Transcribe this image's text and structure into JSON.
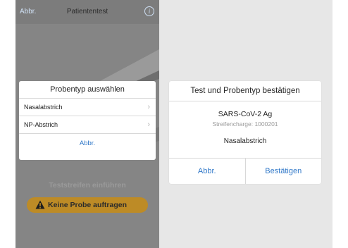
{
  "left": {
    "nav": {
      "cancel": "Abbr.",
      "title": "Patiententest",
      "info_icon": "info-icon"
    },
    "dialog": {
      "title": "Probentyp auswählen",
      "options": [
        {
          "label": "Nasalabstrich",
          "icon": "chevron-right-icon"
        },
        {
          "label": "NP-Abstrich",
          "icon": "chevron-right-icon"
        }
      ],
      "cancel": "Abbr."
    },
    "instruction": "Teststreifen einführen",
    "warning": {
      "icon": "warning-icon",
      "text": "Keine Probe auftragen",
      "color": "#bd8b26"
    }
  },
  "right": {
    "dialog": {
      "title": "Test und Probentyp bestätigen",
      "test_name": "SARS-CoV-2 Ag",
      "lot": "Streifencharge: 1000201",
      "sample_type": "Nasalabstrich",
      "cancel": "Abbr.",
      "confirm": "Bestätigen"
    }
  },
  "colors": {
    "accent": "#2f77c8",
    "dimmed_background": "#858585"
  }
}
